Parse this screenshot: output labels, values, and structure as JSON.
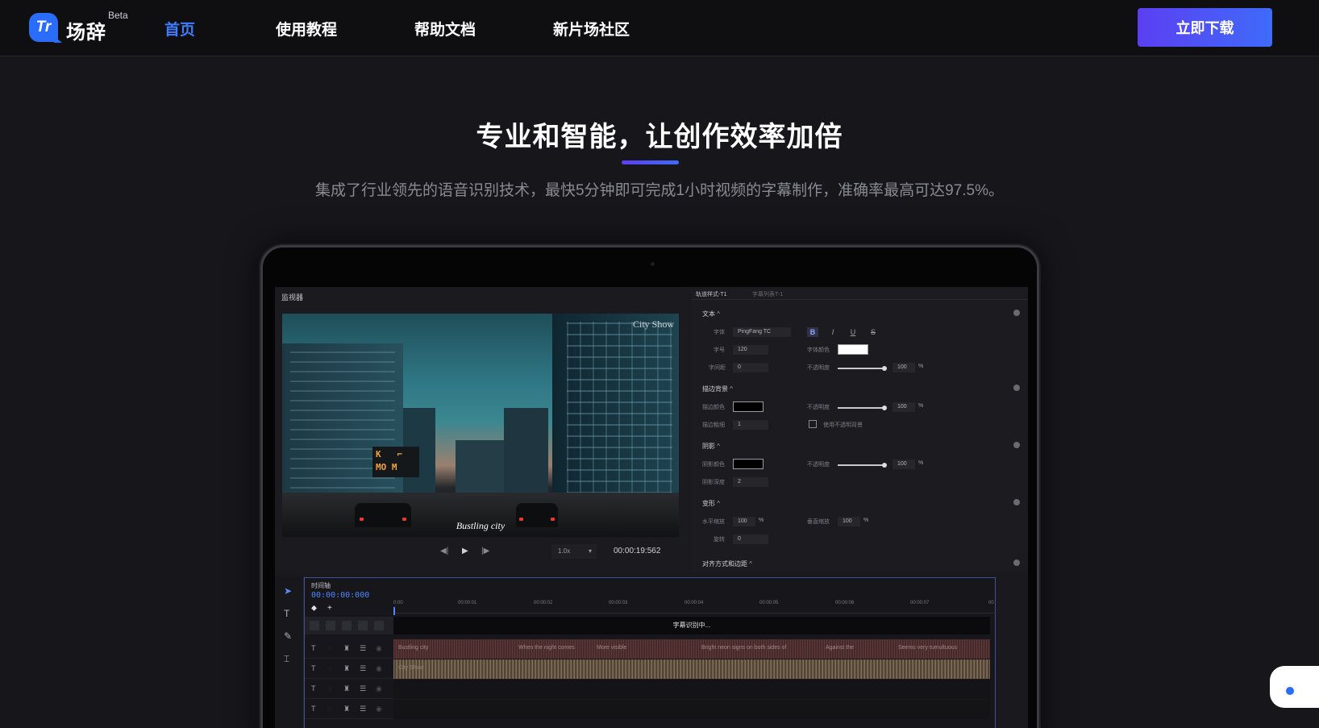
{
  "nav": {
    "logo_mark": "Tr",
    "logo_text": "场辞",
    "logo_badge": "Beta",
    "links": [
      "首页",
      "使用教程",
      "帮助文档",
      "新片场社区"
    ],
    "active_index": 0,
    "download_label": "立即下载"
  },
  "hero": {
    "title": "专业和智能，让创作效率加倍",
    "subtitle": "集成了行业领先的语音识别技术，最快5分钟即可完成1小时视频的字幕制作，准确率最高可达97.5%。"
  },
  "app": {
    "monitor_title": "监视器",
    "video_watermark": "City Show",
    "video_caption": "Bustling city",
    "speed": "1.0x",
    "time": "00:00:19:562",
    "props_tabs": [
      "轨道样式-T1",
      "字幕列表T-1"
    ],
    "sections": {
      "text": "文本",
      "stroke": "描边背景",
      "shadow": "阴影",
      "transform": "变形",
      "align": "对齐方式和边距"
    },
    "text_props": {
      "font_label": "字体",
      "font_value": "PingFang TC",
      "size_label": "字号",
      "size_value": "120",
      "color_label": "字体颜色",
      "spacing_label": "字间距",
      "spacing_value": "0",
      "opacity_label": "不透明度",
      "opacity_value": "100",
      "pct": "%"
    },
    "stroke_props": {
      "color_label": "描边颜色",
      "opacity_label": "不透明度",
      "opacity_value": "100",
      "width_label": "描边粗细",
      "width_value": "1",
      "bg_label": "使用不透明背景"
    },
    "shadow_props": {
      "color_label": "阴影颜色",
      "opacity_label": "不透明度",
      "opacity_value": "100",
      "depth_label": "阴影深度",
      "depth_value": "2"
    },
    "transform_props": {
      "h_label": "水平缩放",
      "h_value": "100",
      "v_label": "垂直缩放",
      "v_value": "100",
      "rot_label": "旋转",
      "rot_value": "0"
    },
    "timeline": {
      "label": "时间轴",
      "time": "00:00:00:000",
      "ticks": [
        "0:00",
        "00:00:01",
        "00:00:02",
        "00:00:03",
        "00:00:04",
        "00:00:05",
        "00:00:06",
        "00:00:07",
        "00"
      ],
      "recognizing": "字幕识别中...",
      "track1_segments": [
        "Bustling city",
        "When the night comes",
        "More visible",
        "Bright neon signs on both sides of",
        "Against the",
        "Seems very tumultuous"
      ],
      "track2_segments": [
        "City Show"
      ]
    }
  },
  "colors": {
    "accent": "#3f7bff",
    "button_gradient_start": "#5b3ff2",
    "button_gradient_end": "#3f6bf8",
    "page_bg": "#16161b"
  }
}
